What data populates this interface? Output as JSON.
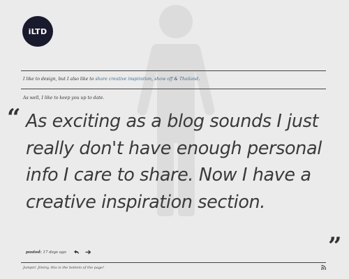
{
  "logo": {
    "text": "iLTD"
  },
  "intro": {
    "prefix": "I like to design, but I also like to ",
    "link1": "share creative inspiration",
    "sep1": ", ",
    "link2": "show off",
    "sep2": " & ",
    "link3": "Thailand",
    "suffix": "."
  },
  "update_line": "As well, I like to keep you up to date.",
  "post": {
    "quote_open": "“",
    "quote_close": "”",
    "text": "As exciting as a blog sounds I just really don't have enough personal info I care to share. Now I have a creative inspiration section.",
    "posted_label": "posted:",
    "posted_time": "17 days ago"
  },
  "footer": {
    "text": "Jumpin' Jiminy, this is the bottom of the page!"
  },
  "colors": {
    "background": "#ebebeb",
    "link": "#3d6f93",
    "logo_bg": "#1a1a2e",
    "figure": "#dcdcdc"
  },
  "icons": {
    "background": "person-silhouette",
    "reply": "reply-arrow-icon",
    "next": "right-arrow-icon",
    "feed": "rss-icon"
  }
}
